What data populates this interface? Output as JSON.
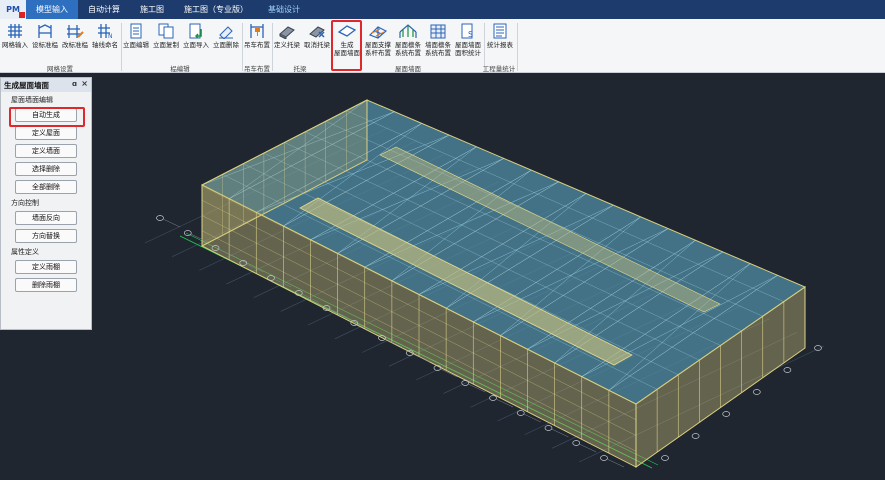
{
  "app": {
    "logo": "PM"
  },
  "tabs": [
    {
      "label": "模型输入",
      "active": true
    },
    {
      "label": "自动计算"
    },
    {
      "label": "施工图"
    },
    {
      "label": "施工图（专业版）"
    },
    {
      "label": "基础设计"
    }
  ],
  "ribbon": {
    "buttons": [
      {
        "label": "网格输入",
        "icon": "grid-icon"
      },
      {
        "label": "设标准榀",
        "icon": "frame-set-icon"
      },
      {
        "label": "改标准榀",
        "icon": "frame-edit-icon"
      },
      {
        "label": "轴线命名",
        "icon": "axis-name-icon"
      },
      {
        "label": "立面编辑",
        "icon": "elevation-edit-icon"
      },
      {
        "label": "立面复制",
        "icon": "elevation-copy-icon"
      },
      {
        "label": "立面导入",
        "icon": "elevation-import-icon"
      },
      {
        "label": "立面删除",
        "icon": "elevation-delete-icon"
      },
      {
        "label": "吊车布置",
        "icon": "crane-icon"
      },
      {
        "label": "定义托梁",
        "icon": "define-beam-icon"
      },
      {
        "label": "取消托梁",
        "icon": "cancel-beam-icon"
      },
      {
        "label": "生成\n屋面墙面",
        "icon": "roof-wall-icon"
      },
      {
        "label": "屋面支撑\n系杆布置",
        "icon": "roof-brace-icon"
      },
      {
        "label": "屋面檩条\n系统布置",
        "icon": "roof-purlin-icon"
      },
      {
        "label": "墙面檩条\n系统布置",
        "icon": "wall-purlin-icon"
      },
      {
        "label": "屋面墙面\n面积统计",
        "icon": "area-stat-icon"
      },
      {
        "label": "统计报表",
        "icon": "report-icon"
      }
    ],
    "groups": [
      "网格设置",
      "榀编辑",
      "吊车布置",
      "托梁",
      "屋面墙面",
      "工程量统计"
    ]
  },
  "panel": {
    "title": "生成屋面墙面",
    "pin": "ɑ",
    "close": "×",
    "sections": [
      {
        "title": "屋面墙面编辑",
        "buttons": [
          "自动生成",
          "定义屋面",
          "定义墙面",
          "选择删除",
          "全部删除"
        ]
      },
      {
        "title": "方向控制",
        "buttons": [
          "墙面反向",
          "方向替换"
        ]
      },
      {
        "title": "属性定义",
        "buttons": [
          "定义雨棚",
          "删除雨棚"
        ]
      }
    ]
  },
  "colors": {
    "tabbar": "#1d3c6d",
    "tabActive": "#2f6fc0",
    "canvas": "#1f2630",
    "roof": "#4a9cc4",
    "wall": "#b8b070",
    "highlight": "#e0272c"
  }
}
